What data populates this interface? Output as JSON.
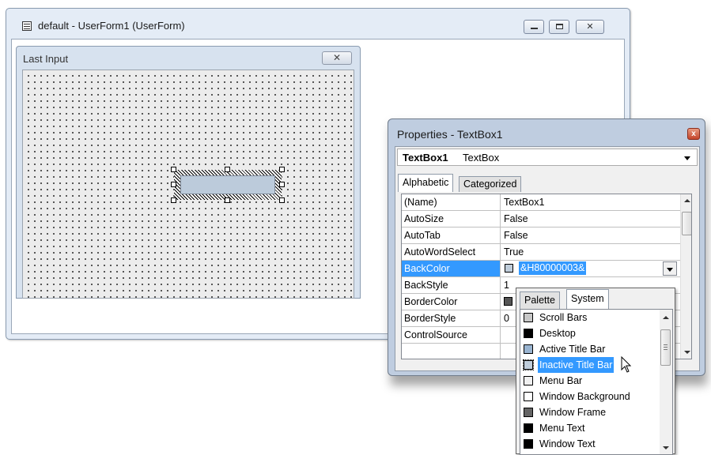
{
  "main_window": {
    "title": "default - UserForm1 (UserForm)",
    "close_glyph": "✕"
  },
  "userform": {
    "caption": "Last Input",
    "close_glyph": "✕"
  },
  "properties": {
    "title": "Properties - TextBox1",
    "close_glyph": "x",
    "object_name": "TextBox1",
    "object_type": "TextBox",
    "tabs": [
      "Alphabetic",
      "Categorized"
    ],
    "rows": [
      {
        "name": "(Name)",
        "value": "TextBox1"
      },
      {
        "name": "AutoSize",
        "value": "False"
      },
      {
        "name": "AutoTab",
        "value": "False"
      },
      {
        "name": "AutoWordSelect",
        "value": "True"
      },
      {
        "name": "BackColor",
        "value": "&H80000003&",
        "swatch_color": "#bfcddb"
      },
      {
        "name": "BackStyle",
        "value": "1"
      },
      {
        "name": "BorderColor",
        "value": ""
      },
      {
        "name": "BorderStyle",
        "value": "0"
      },
      {
        "name": "ControlSource",
        "value": ""
      }
    ]
  },
  "color_popup": {
    "tabs": [
      "Palette",
      "System"
    ],
    "items": [
      {
        "label": "Scroll Bars",
        "color": "#c8c8c8"
      },
      {
        "label": "Desktop",
        "color": "#000000"
      },
      {
        "label": "Active Title Bar",
        "color": "#99b4d1"
      },
      {
        "label": "Inactive Title Bar",
        "color": "#bfcddb",
        "selected": true
      },
      {
        "label": "Menu Bar",
        "color": "#f0f0f0"
      },
      {
        "label": "Window Background",
        "color": "#ffffff"
      },
      {
        "label": "Window Frame",
        "color": "#646464"
      },
      {
        "label": "Menu Text",
        "color": "#000000"
      },
      {
        "label": "Window Text",
        "color": "#000000"
      }
    ]
  },
  "icons": [
    "userform-icon",
    "minimize-icon",
    "maximize-icon",
    "close-icon",
    "dropdown-arrow-icon",
    "mouse-pointer-icon"
  ]
}
